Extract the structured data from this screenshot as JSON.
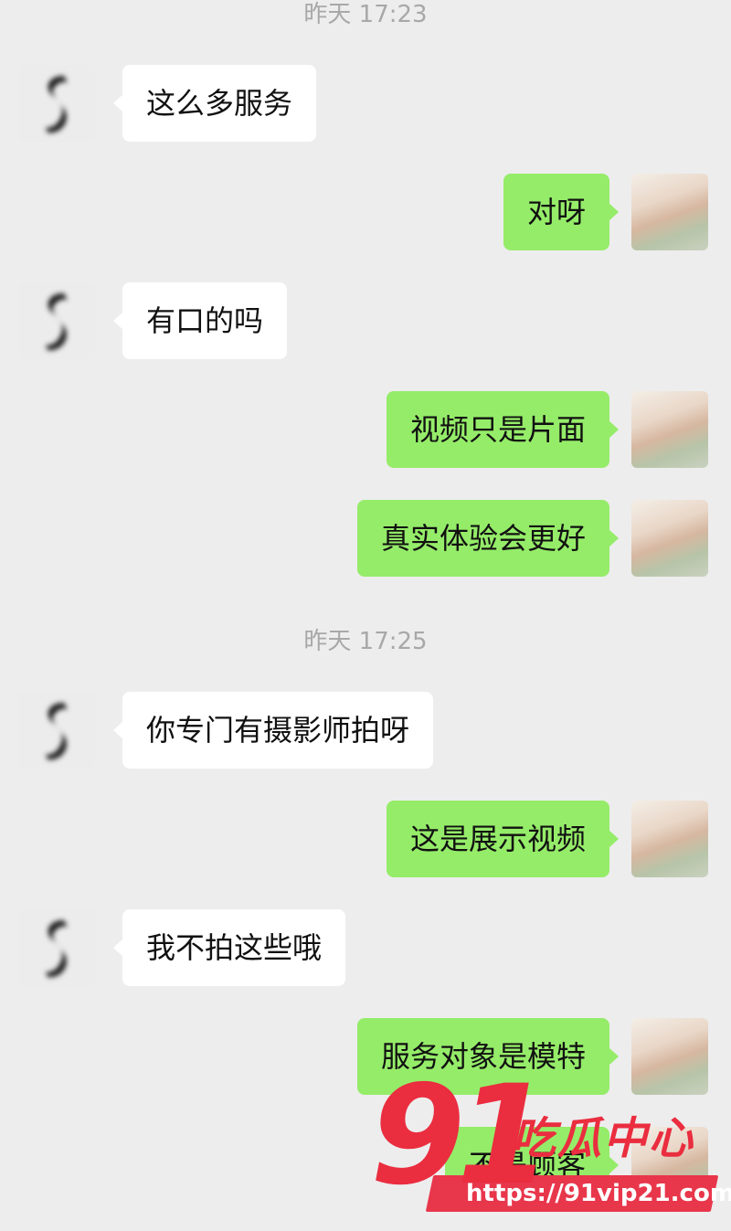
{
  "timestamps": [
    "昨天 17:23",
    "昨天 17:25"
  ],
  "messages": [
    {
      "side": "left",
      "text": "这么多服务"
    },
    {
      "side": "right",
      "text": "对呀"
    },
    {
      "side": "left",
      "text": "有口的吗"
    },
    {
      "side": "right",
      "text": "视频只是片面"
    },
    {
      "side": "right",
      "text": "真实体验会更好"
    },
    {
      "side": "left",
      "text": "你专门有摄影师拍呀"
    },
    {
      "side": "right",
      "text": "这是展示视频"
    },
    {
      "side": "left",
      "text": "我不拍这些哦"
    },
    {
      "side": "right",
      "text": "服务对象是模特"
    },
    {
      "side": "right",
      "text": "不是顾客"
    }
  ],
  "colors": {
    "background": "#ededed",
    "incoming_bubble": "#ffffff",
    "outgoing_bubble": "#95ec69",
    "watermark": "#ea2d3f"
  },
  "watermark": {
    "logo_number": "91",
    "title": "吃瓜中心",
    "url": "https://91vip21.com"
  }
}
